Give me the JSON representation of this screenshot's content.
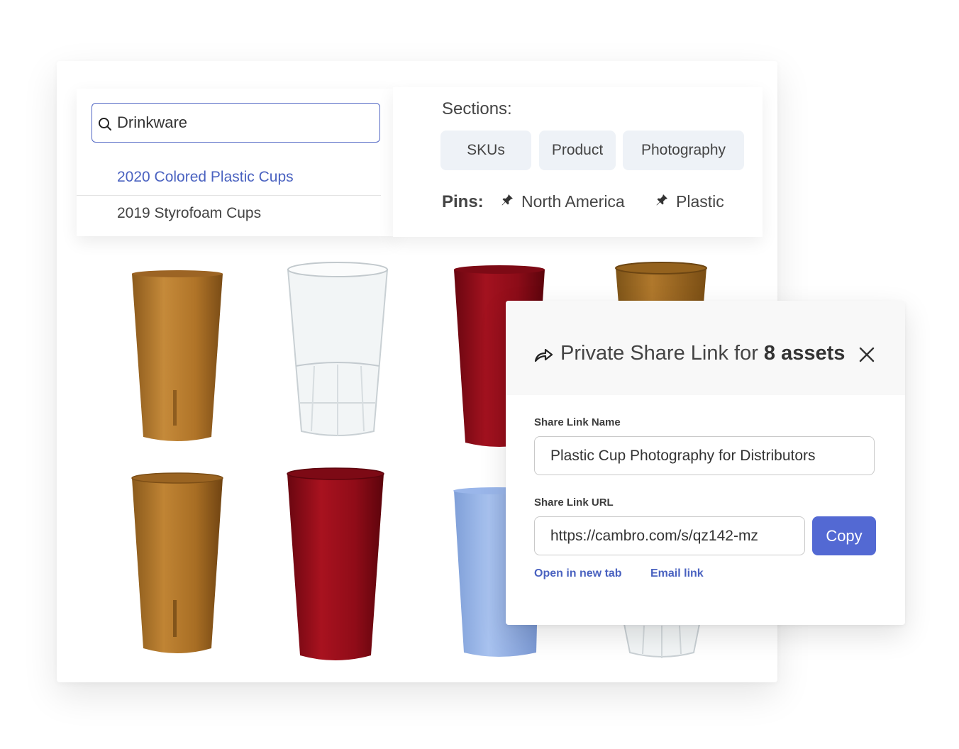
{
  "search": {
    "value": "Drinkware",
    "results": [
      {
        "label": "2020 Colored Plastic Cups"
      },
      {
        "label": "2019 Styrofoam Cups"
      }
    ]
  },
  "filters": {
    "sections_label": "Sections:",
    "sections": [
      "SKUs",
      "Product",
      "Photography"
    ],
    "pins_label": "Pins:",
    "pins": [
      "North America",
      "Plastic"
    ]
  },
  "assets": [
    {
      "color": "#b57a2c",
      "style": "amber-textured"
    },
    {
      "color": "#e8ecef",
      "style": "clear-faceted"
    },
    {
      "color": "#8a0e1a",
      "style": "red"
    },
    {
      "color": "#a36a22",
      "style": "amber"
    },
    {
      "color": "#a76a24",
      "style": "amber"
    },
    {
      "color": "#920d18",
      "style": "red"
    },
    {
      "color": "#8fb0e6",
      "style": "blue"
    },
    {
      "color": "#e8ecef",
      "style": "clear"
    }
  ],
  "share_modal": {
    "title_prefix": "Private Share Link for",
    "title_count": "8 assets",
    "name_label": "Share Link Name",
    "name_value": "Plastic Cup Photography for Distributors",
    "url_label": "Share Link URL",
    "url_value": "https://cambro.com/s/qz142-mz",
    "copy_label": "Copy",
    "open_link": "Open in new tab",
    "email_link": "Email link"
  },
  "colors": {
    "accent": "#5369d3",
    "link": "#4a62c0",
    "chip_bg": "#eef2f7"
  }
}
